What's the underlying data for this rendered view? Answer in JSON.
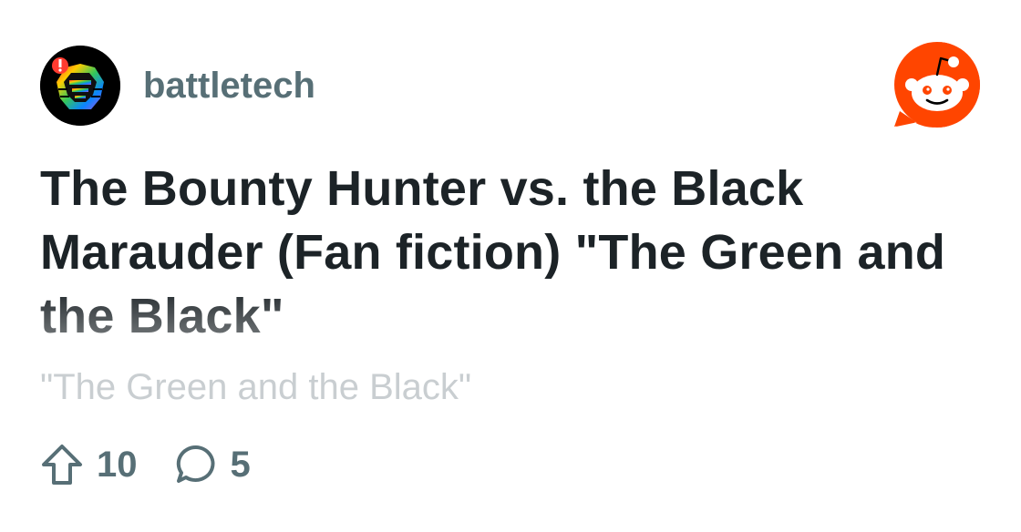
{
  "post": {
    "subreddit": "battletech",
    "title": "The Bounty Hunter vs. the Black Marauder (Fan fiction) \"The Green and the Black\"",
    "body_preview": "\"The Green and the Black\"",
    "upvotes": "10",
    "comments": "5"
  },
  "icons": {
    "avatar": "battletech-rainbow-mech-head-icon",
    "brand": "reddit-snoo-logo-icon",
    "upvote": "upvote-arrow-icon",
    "comment": "comment-bubble-icon"
  },
  "colors": {
    "brand_orange": "#ff4500",
    "title_text": "#1c2327",
    "meta_text": "#576f76",
    "preview_text": "#c9ced1"
  }
}
